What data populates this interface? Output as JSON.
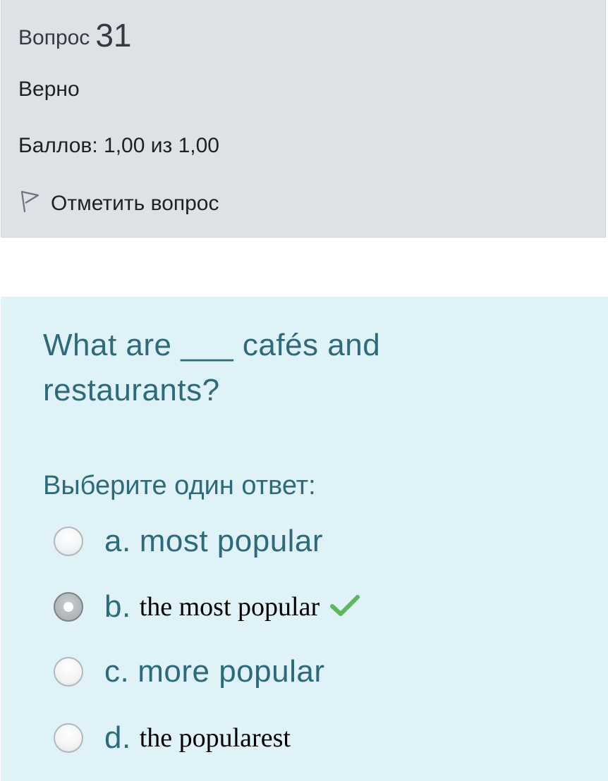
{
  "info": {
    "question_label": "Вопрос",
    "question_number": "31",
    "state": "Верно",
    "grade": "Баллов: 1,00 из 1,00",
    "flag_label": "Отметить вопрос"
  },
  "question": {
    "text": "What are ___ cafés and restaurants?",
    "prompt": "Выберите один ответ:",
    "answers": [
      {
        "letter": "a.",
        "text": "most popular",
        "selected": false,
        "correct": false
      },
      {
        "letter": "b.",
        "text": "the most popular",
        "selected": true,
        "correct": true
      },
      {
        "letter": "c.",
        "text": "more popular",
        "selected": false,
        "correct": false
      },
      {
        "letter": "d.",
        "text": "the popularest",
        "selected": false,
        "correct": false
      }
    ]
  },
  "colors": {
    "info_bg": "#dee2e6",
    "content_bg": "#def2f8",
    "question_text": "#2d6a7a",
    "correct_check": "#5cb85c"
  },
  "icons": {
    "flag": "flag-icon",
    "correct": "check-icon"
  }
}
